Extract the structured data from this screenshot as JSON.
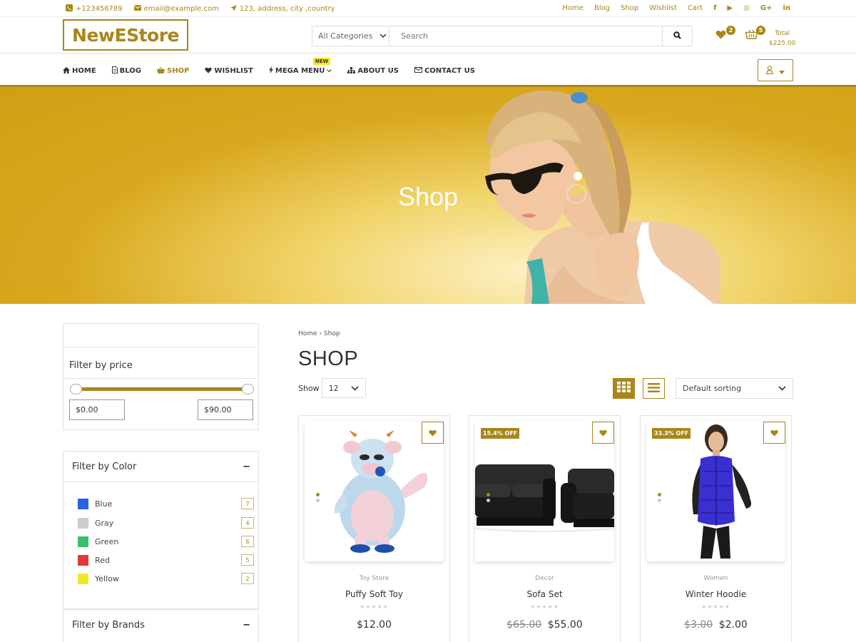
{
  "topbar": {
    "phone": "+123456789",
    "email": "email@example.com",
    "address": "123, address, city ,country",
    "links": [
      "Home",
      "Blog",
      "Shop",
      "Wishlist",
      "Cart"
    ],
    "social": [
      "f",
      "▶",
      "◎",
      "G+",
      "in"
    ]
  },
  "header": {
    "logo": "NewEStore",
    "category_select": "All Categories",
    "search_placeholder": "Search",
    "wishlist_count": "2",
    "cart_count": "5",
    "total_label": "Total",
    "total_value": "$225.00"
  },
  "nav": {
    "items": [
      {
        "label": "HOME",
        "icon": "home-icon"
      },
      {
        "label": "BLOG",
        "icon": "document-icon"
      },
      {
        "label": "SHOP",
        "icon": "basket-icon"
      },
      {
        "label": "WISHLIST",
        "icon": "heart-icon"
      },
      {
        "label": "MEGA MENU",
        "icon": "bolt-icon"
      },
      {
        "label": "ABOUT US",
        "icon": "sitemap-icon"
      },
      {
        "label": "CONTACT US",
        "icon": "envelope-icon"
      }
    ],
    "new_tag": "NEW"
  },
  "hero": {
    "title": "Shop"
  },
  "sidebar": {
    "price_title": "Filter by price",
    "price_min": "$0.00",
    "price_max": "$90.00",
    "color_title": "Filter by Color",
    "colors": [
      {
        "name": "Blue",
        "count": "7",
        "hex": "#2b63e5"
      },
      {
        "name": "Gray",
        "count": "4",
        "hex": "#cccccc"
      },
      {
        "name": "Green",
        "count": "6",
        "hex": "#3dbe6a"
      },
      {
        "name": "Red",
        "count": "5",
        "hex": "#e03a3a"
      },
      {
        "name": "Yellow",
        "count": "2",
        "hex": "#eee82a"
      }
    ],
    "brands_title": "Filter by Brands",
    "collapse_symbol": "−"
  },
  "main": {
    "breadcrumb": "Home › Shop",
    "title": "SHOP",
    "show_label": "Show",
    "show_value": "12",
    "sort_value": "Default sorting"
  },
  "products": [
    {
      "category": "Toy Store",
      "name": "Puffy Soft Toy",
      "price": "$12.00",
      "old_price": "",
      "discount": ""
    },
    {
      "category": "Decor",
      "name": "Sofa Set",
      "price": "$55.00",
      "old_price": "$65.00",
      "discount": "15.4% OFF"
    },
    {
      "category": "Women",
      "name": "Winter Hoodie",
      "price": "$2.00",
      "old_price": "$3.00",
      "discount": "33.3% OFF"
    }
  ],
  "colors": {
    "accent": "#a8861a",
    "hero": "#d4a51a"
  }
}
